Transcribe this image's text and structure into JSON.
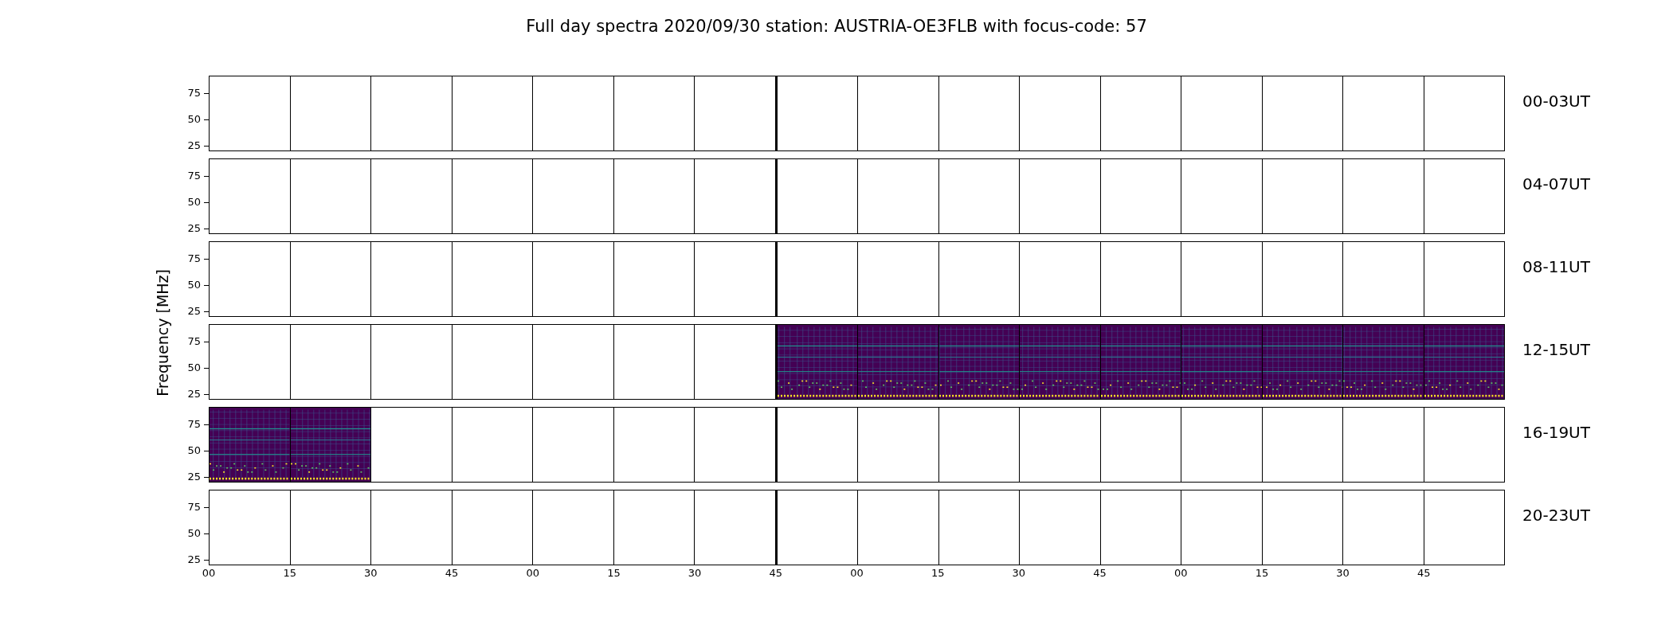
{
  "title": "Full day spectra 2020/09/30 station: AUSTRIA-OE3FLB with focus-code: 57",
  "ylabel": "Frequency [MHz]",
  "rows": [
    {
      "label": "00-03UT",
      "yticks": [
        "75",
        "50",
        "25"
      ],
      "panels": [
        {
          "has_data": false
        },
        {
          "has_data": false
        },
        {
          "has_data": false
        },
        {
          "has_data": false
        },
        {
          "has_data": false
        },
        {
          "has_data": false
        },
        {
          "has_data": false
        },
        {
          "has_data": false
        },
        {
          "has_data": false
        },
        {
          "has_data": false
        },
        {
          "has_data": false
        },
        {
          "has_data": false
        },
        {
          "has_data": false
        },
        {
          "has_data": false
        },
        {
          "has_data": false
        },
        {
          "has_data": false
        }
      ]
    },
    {
      "label": "04-07UT",
      "yticks": [
        "75",
        "50",
        "25"
      ],
      "panels": [
        {
          "has_data": false
        },
        {
          "has_data": false
        },
        {
          "has_data": false
        },
        {
          "has_data": false
        },
        {
          "has_data": false
        },
        {
          "has_data": false
        },
        {
          "has_data": false
        },
        {
          "has_data": false
        },
        {
          "has_data": false
        },
        {
          "has_data": false
        },
        {
          "has_data": false
        },
        {
          "has_data": false
        },
        {
          "has_data": false
        },
        {
          "has_data": false
        },
        {
          "has_data": false
        },
        {
          "has_data": false
        }
      ]
    },
    {
      "label": "08-11UT",
      "yticks": [
        "75",
        "50",
        "25"
      ],
      "panels": [
        {
          "has_data": false
        },
        {
          "has_data": false
        },
        {
          "has_data": false
        },
        {
          "has_data": false
        },
        {
          "has_data": false
        },
        {
          "has_data": false
        },
        {
          "has_data": false
        },
        {
          "has_data": false
        },
        {
          "has_data": false
        },
        {
          "has_data": false
        },
        {
          "has_data": false
        },
        {
          "has_data": false
        },
        {
          "has_data": false
        },
        {
          "has_data": false
        },
        {
          "has_data": false
        },
        {
          "has_data": false
        }
      ]
    },
    {
      "label": "12-15UT",
      "yticks": [
        "75",
        "50",
        "25"
      ],
      "panels": [
        {
          "has_data": false
        },
        {
          "has_data": false
        },
        {
          "has_data": false
        },
        {
          "has_data": false
        },
        {
          "has_data": false
        },
        {
          "has_data": false
        },
        {
          "has_data": false
        },
        {
          "has_data": true
        },
        {
          "has_data": true
        },
        {
          "has_data": true
        },
        {
          "has_data": true
        },
        {
          "has_data": true
        },
        {
          "has_data": true
        },
        {
          "has_data": true
        },
        {
          "has_data": true
        },
        {
          "has_data": true
        }
      ]
    },
    {
      "label": "16-19UT",
      "yticks": [
        "75",
        "50",
        "25"
      ],
      "panels": [
        {
          "has_data": true
        },
        {
          "has_data": true
        },
        {
          "has_data": false
        },
        {
          "has_data": false
        },
        {
          "has_data": false
        },
        {
          "has_data": false
        },
        {
          "has_data": false
        },
        {
          "has_data": false
        },
        {
          "has_data": false
        },
        {
          "has_data": false
        },
        {
          "has_data": false
        },
        {
          "has_data": false
        },
        {
          "has_data": false
        },
        {
          "has_data": false
        },
        {
          "has_data": false
        },
        {
          "has_data": false
        }
      ]
    },
    {
      "label": "20-23UT",
      "yticks": [
        "75",
        "50",
        "25"
      ],
      "panels": [
        {
          "has_data": false
        },
        {
          "has_data": false
        },
        {
          "has_data": false
        },
        {
          "has_data": false
        },
        {
          "has_data": false
        },
        {
          "has_data": false
        },
        {
          "has_data": false
        },
        {
          "has_data": false
        },
        {
          "has_data": false
        },
        {
          "has_data": false
        },
        {
          "has_data": false
        },
        {
          "has_data": false
        },
        {
          "has_data": false
        },
        {
          "has_data": false
        },
        {
          "has_data": false
        },
        {
          "has_data": false
        }
      ]
    }
  ],
  "xticks": [
    "00",
    "15",
    "30",
    "45",
    "00",
    "15",
    "30",
    "45",
    "00",
    "15",
    "30",
    "45",
    "00",
    "15",
    "30",
    "45"
  ]
}
